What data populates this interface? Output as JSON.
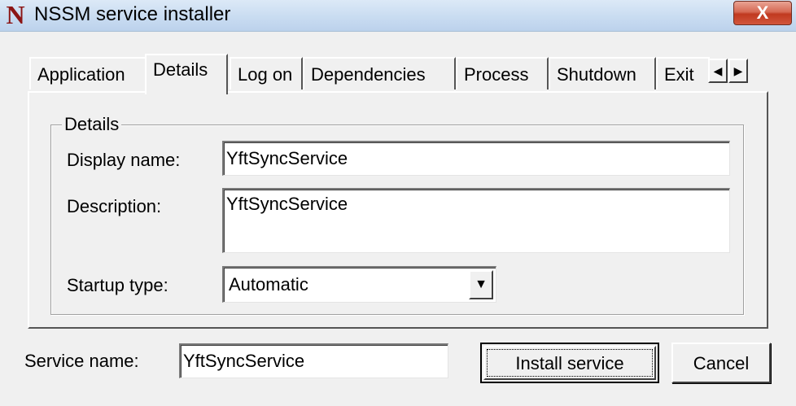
{
  "window": {
    "title": "NSSM service installer",
    "app_icon_letter": "N",
    "close_glyph": "X"
  },
  "tabs": [
    {
      "label": "Application",
      "active": false
    },
    {
      "label": "Details",
      "active": true
    },
    {
      "label": "Log on",
      "active": false
    },
    {
      "label": "Dependencies",
      "active": false
    },
    {
      "label": "Process",
      "active": false
    },
    {
      "label": "Shutdown",
      "active": false
    },
    {
      "label": "Exit",
      "active": false
    }
  ],
  "tab_scroll": {
    "left_glyph": "◀",
    "right_glyph": "▶"
  },
  "details": {
    "group_label": "Details",
    "display_name_label": "Display name:",
    "display_name_value": "YftSyncService",
    "description_label": "Description:",
    "description_value": "YftSyncService",
    "startup_type_label": "Startup type:",
    "startup_type_value": "Automatic",
    "dropdown_glyph": "▼"
  },
  "footer": {
    "service_name_label": "Service name:",
    "service_name_value": "YftSyncService",
    "install_label": "Install service",
    "cancel_label": "Cancel"
  },
  "colors": {
    "window_bg": "#f0f0f0",
    "title_bar": "#c9dcf1",
    "close_button": "#c0391f",
    "app_icon": "#8b1515"
  },
  "icons": {
    "app": "nssm-logo-icon",
    "close": "close-icon",
    "scroll_left": "triangle-left-icon",
    "scroll_right": "triangle-right-icon",
    "dropdown": "triangle-down-icon"
  }
}
